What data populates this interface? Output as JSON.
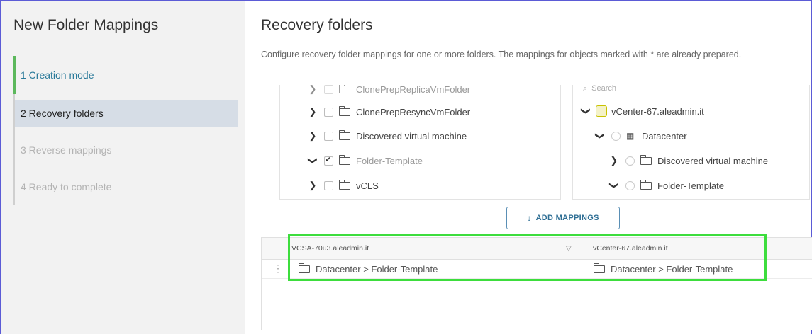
{
  "wizard": {
    "title": "New Folder Mappings",
    "steps": [
      {
        "label": "1  Creation mode",
        "state": "done"
      },
      {
        "label": "2  Recovery folders",
        "state": "active"
      },
      {
        "label": "3  Reverse mappings",
        "state": "disabled"
      },
      {
        "label": "4  Ready to complete",
        "state": "disabled"
      }
    ]
  },
  "page": {
    "title": "Recovery folders",
    "description": "Configure recovery folder mappings for one or more folders. The mappings for objects marked with * are already prepared."
  },
  "left_tree": {
    "items": [
      {
        "label": "ClonePrepReplicaVmFolder",
        "expanded": false,
        "checked": false
      },
      {
        "label": "ClonePrepResyncVmFolder",
        "expanded": false,
        "checked": false
      },
      {
        "label": "Discovered virtual machine",
        "expanded": false,
        "checked": false
      },
      {
        "label": "Folder-Template",
        "expanded": true,
        "checked": true
      },
      {
        "label": "vCLS",
        "expanded": false,
        "checked": false
      }
    ]
  },
  "right_tree": {
    "search_placeholder": "Search",
    "root": "vCenter-67.aleadmin.it",
    "datacenter": "Datacenter",
    "children": [
      {
        "label": "Discovered virtual machine",
        "expanded": false
      },
      {
        "label": "Folder-Template",
        "expanded": true
      }
    ]
  },
  "actions": {
    "add_mappings": "ADD MAPPINGS"
  },
  "mappings_grid": {
    "columns": [
      "VCSA-70u3.aleadmin.it",
      "vCenter-67.aleadmin.it"
    ],
    "rows": [
      {
        "source": "Datacenter > Folder-Template",
        "target": "Datacenter > Folder-Template"
      }
    ]
  },
  "colors": {
    "accent": "#2f6f95",
    "highlight": "#3ddd3d",
    "done_step": "#5cb85c"
  }
}
